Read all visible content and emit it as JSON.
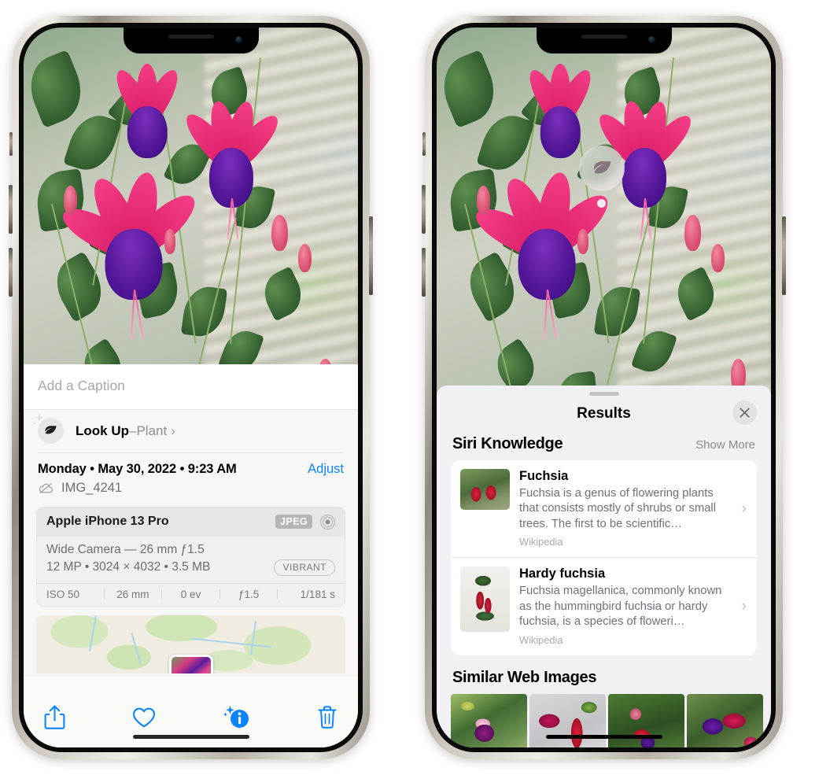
{
  "left_phone": {
    "name": "photos-detail-view",
    "caption": {
      "placeholder": "Add a Caption",
      "value": ""
    },
    "look_up": {
      "label_bold": "Look Up",
      "dash": " – ",
      "label_dim": "Plant",
      "chevron": "›",
      "icon": "leaf-icon",
      "sparkle_icon": "sparkles-icon"
    },
    "metadata": {
      "date_line": "Monday • May 30, 2022 • 9:23 AM",
      "adjust_label": "Adjust",
      "filename": "IMG_4241",
      "cloud_icon": "icloud-slash-icon"
    },
    "exif": {
      "model": "Apple iPhone 13 Pro",
      "format_badge": "JPEG",
      "lens_icon": "camera-lens-icon",
      "lens_line": "Wide Camera — 26 mm ƒ1.5",
      "size_line": "12 MP • 3024 × 4032 • 3.5 MB",
      "style_badge": "VIBRANT",
      "settings": [
        "ISO 50",
        "26 mm",
        "0 ev",
        "ƒ1.5",
        "1/181 s"
      ]
    },
    "toolbar": [
      {
        "name": "share-button",
        "icon": "share-icon"
      },
      {
        "name": "favorite-button",
        "icon": "heart-icon"
      },
      {
        "name": "info-button",
        "icon": "info-sparkle-icon"
      },
      {
        "name": "delete-button",
        "icon": "trash-icon"
      }
    ],
    "accent_color": "#0a84ff"
  },
  "right_phone": {
    "name": "visual-look-up-results",
    "badge": {
      "icon": "leaf-icon",
      "label": "visual-look-up-badge"
    },
    "panel": {
      "title": "Results",
      "close_icon": "close-x-icon",
      "grabber": "drag-handle"
    },
    "siri_knowledge": {
      "section_title": "Siri Knowledge",
      "show_more": "Show More",
      "items": [
        {
          "title": "Fuchsia",
          "description": "Fuchsia is a genus of flowering plants that consists mostly of shrubs or small trees. The first to be scientific…",
          "source": "Wikipedia",
          "chevron": "›"
        },
        {
          "title": "Hardy fuchsia",
          "description": "Fuchsia magellanica, commonly known as the hummingbird fuchsia or hardy fuchsia, is a species of floweri…",
          "source": "Wikipedia",
          "chevron": "›"
        }
      ]
    },
    "similar_web_images": {
      "section_title": "Similar Web Images",
      "thumbnails": [
        {
          "name": "web-image-1"
        },
        {
          "name": "web-image-2"
        },
        {
          "name": "web-image-3"
        },
        {
          "name": "web-image-4"
        }
      ]
    }
  }
}
